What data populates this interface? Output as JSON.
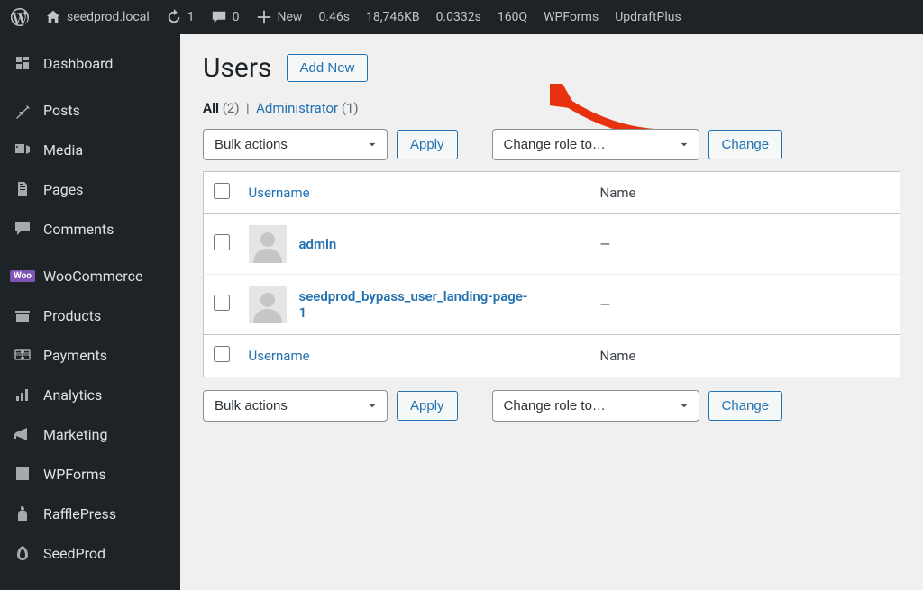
{
  "toolbar": {
    "site_name": "seedprod.local",
    "refresh_count": "1",
    "comments_count": "0",
    "new_label": "New",
    "stats": [
      "0.46s",
      "18,746KB",
      "0.0332s",
      "160Q"
    ],
    "items": [
      "WPForms",
      "UpdraftPlus"
    ]
  },
  "sidebar": {
    "items": [
      {
        "icon": "dashboard",
        "label": "Dashboard"
      },
      {
        "icon": "posts",
        "label": "Posts"
      },
      {
        "icon": "media",
        "label": "Media"
      },
      {
        "icon": "pages",
        "label": "Pages"
      },
      {
        "icon": "comments",
        "label": "Comments"
      },
      {
        "icon": "woo",
        "label": "WooCommerce"
      },
      {
        "icon": "products",
        "label": "Products"
      },
      {
        "icon": "payments",
        "label": "Payments"
      },
      {
        "icon": "analytics",
        "label": "Analytics"
      },
      {
        "icon": "marketing",
        "label": "Marketing"
      },
      {
        "icon": "wpforms",
        "label": "WPForms"
      },
      {
        "icon": "rafflepress",
        "label": "RafflePress"
      },
      {
        "icon": "seedprod",
        "label": "SeedProd"
      }
    ]
  },
  "page": {
    "title": "Users",
    "add_new": "Add New",
    "filter_all_label": "All",
    "filter_all_count": "(2)",
    "filter_sep": "|",
    "filter_admin_label": "Administrator",
    "filter_admin_count": "(1)",
    "bulk_actions_label": "Bulk actions",
    "apply_label": "Apply",
    "change_role_label": "Change role to…",
    "change_label": "Change",
    "table": {
      "col_username": "Username",
      "col_name": "Name",
      "rows": [
        {
          "username": "admin",
          "name": "—"
        },
        {
          "username": "seedprod_bypass_user_landing-page-1",
          "name": "—"
        }
      ]
    }
  }
}
